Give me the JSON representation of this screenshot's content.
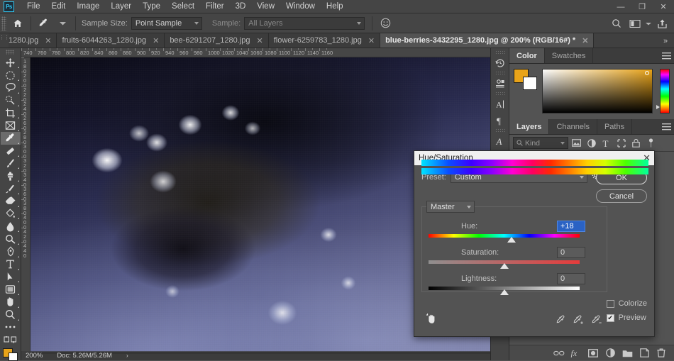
{
  "app": {
    "logo": "Ps",
    "menu": [
      "File",
      "Edit",
      "Image",
      "Layer",
      "Type",
      "Select",
      "Filter",
      "3D",
      "View",
      "Window",
      "Help"
    ],
    "window_buttons": [
      {
        "name": "minimize",
        "glyph": "—"
      },
      {
        "name": "restore",
        "glyph": "❐"
      },
      {
        "name": "close",
        "glyph": "✕"
      }
    ]
  },
  "options_bar": {
    "home_icon": "home-icon",
    "tool_icon": "eyedropper-icon",
    "sample_size_label": "Sample Size:",
    "sample_size_value": "Point Sample",
    "sample_label": "Sample:",
    "sample_value": "All Layers",
    "extra_icon": "smiley-icon",
    "right_icons": [
      "search-icon",
      "workspace-icon",
      "share-icon"
    ]
  },
  "tabs": [
    {
      "label": "1280.jpg",
      "active": false,
      "cut": true
    },
    {
      "label": "fruits-6044263_1280.jpg",
      "active": false,
      "cut": false
    },
    {
      "label": "bee-6291207_1280.jpg",
      "active": false,
      "cut": false
    },
    {
      "label": "flower-6259783_1280.jpg",
      "active": false,
      "cut": false
    },
    {
      "label": "blue-berries-3432295_1280.jpg @ 200% (RGB/16#) *",
      "active": true,
      "cut": false
    }
  ],
  "tab_overflow": "»",
  "toolbar": {
    "tools": [
      {
        "name": "move-tool",
        "icon": "move-icon",
        "active": false
      },
      {
        "name": "marquee-tool",
        "icon": "elliptical-marquee-icon",
        "active": false
      },
      {
        "name": "lasso-tool",
        "icon": "lasso-icon",
        "active": false
      },
      {
        "name": "quick-select-tool",
        "icon": "magic-wand-icon",
        "active": false
      },
      {
        "name": "crop-tool",
        "icon": "crop-icon",
        "active": false
      },
      {
        "name": "frame-tool",
        "icon": "frame-icon",
        "active": false
      },
      {
        "name": "eyedropper-tool",
        "icon": "eyedropper-icon",
        "active": true
      },
      {
        "name": "healing-brush-tool",
        "icon": "spot-healing-icon",
        "active": false
      },
      {
        "name": "brush-tool",
        "icon": "brush-icon",
        "active": false
      },
      {
        "name": "clone-stamp-tool",
        "icon": "clone-stamp-icon",
        "active": false
      },
      {
        "name": "history-brush-tool",
        "icon": "history-brush-icon",
        "active": false
      },
      {
        "name": "eraser-tool",
        "icon": "eraser-icon",
        "active": false
      },
      {
        "name": "gradient-tool",
        "icon": "paint-bucket-icon",
        "active": false
      },
      {
        "name": "blur-tool",
        "icon": "blur-drop-icon",
        "active": false
      },
      {
        "name": "dodge-tool",
        "icon": "dodge-icon",
        "active": false
      },
      {
        "name": "pen-tool",
        "icon": "pen-icon",
        "active": false
      },
      {
        "name": "type-tool",
        "icon": "type-t-icon",
        "active": false
      },
      {
        "name": "path-select-tool",
        "icon": "path-arrow-icon",
        "active": false
      },
      {
        "name": "shape-tool",
        "icon": "rectangle-shape-icon",
        "active": false
      },
      {
        "name": "hand-tool",
        "icon": "hand-icon",
        "active": false
      },
      {
        "name": "zoom-tool",
        "icon": "magnifier-icon",
        "active": false
      },
      {
        "name": "edit-toolbar",
        "icon": "ellipsis-icon",
        "active": false
      },
      {
        "name": "quick-mask",
        "icon": "quick-mask-icon",
        "active": false
      }
    ],
    "foreground_color": "#e8a319",
    "background_color": "#ffffff"
  },
  "rulers": {
    "horizontal_start": 740,
    "horizontal_end": 1160,
    "horizontal_step": 20,
    "vertical_start": 180,
    "vertical_end": 440,
    "vertical_step": 20
  },
  "status_bar": {
    "zoom": "200%",
    "doc_info": "Doc: 5.26M/5.26M",
    "arrow": "›"
  },
  "color_panel": {
    "tabs": [
      {
        "label": "Color",
        "active": true
      },
      {
        "label": "Swatches",
        "active": false
      }
    ],
    "menu_icon": "panel-menu-icon",
    "foreground": "#e8a319",
    "background": "#ffffff"
  },
  "layers_panel": {
    "tabs": [
      {
        "label": "Layers",
        "active": true
      },
      {
        "label": "Channels",
        "active": false
      },
      {
        "label": "Paths",
        "active": false
      }
    ],
    "menu_icon": "panel-menu-icon",
    "filter_label": "Kind",
    "filter_icons": [
      "pixel-filter-icon",
      "adjustment-filter-icon",
      "type-filter-icon",
      "shape-filter-icon",
      "smart-object-filter-icon",
      "filter-toggle-icon"
    ],
    "footer_icons": [
      "link-layers-icon",
      "layer-fx-icon",
      "add-mask-icon",
      "new-adjustment-icon",
      "new-group-icon",
      "new-layer-icon",
      "delete-layer-icon"
    ]
  },
  "icon_column": [
    "history-icon",
    "properties-icon",
    "character-icon",
    "paragraph-icon",
    "glyphs-icon"
  ],
  "dialog": {
    "title": "Hue/Saturation",
    "close_glyph": "✕",
    "preset_label": "Preset:",
    "preset_value": "Custom",
    "gear_icon": "gear-icon",
    "ok_label": "OK",
    "cancel_label": "Cancel",
    "channel_value": "Master",
    "sliders": [
      {
        "name": "Hue:",
        "value": "+18",
        "selected": true,
        "thumb_pct": 55,
        "track": "hue"
      },
      {
        "name": "Saturation:",
        "value": "0",
        "selected": false,
        "thumb_pct": 50,
        "track": "sat"
      },
      {
        "name": "Lightness:",
        "value": "0",
        "selected": false,
        "thumb_pct": 50,
        "track": "lig"
      }
    ],
    "colorize_label": "Colorize",
    "colorize_checked": false,
    "preview_label": "Preview",
    "preview_checked": true,
    "check_glyph": "✔",
    "scrub_icon": "scrubby-hand-icon",
    "eyedropper_icons": [
      "eyedropper-icon",
      "eyedropper-add-icon",
      "eyedropper-subtract-icon"
    ]
  }
}
